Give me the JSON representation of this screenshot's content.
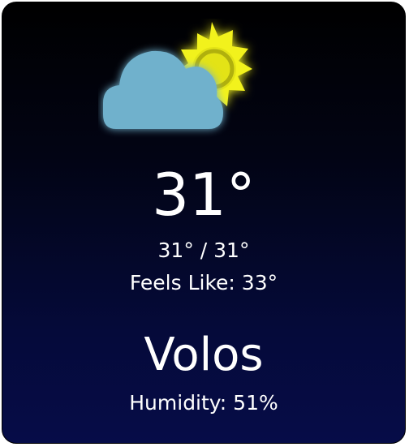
{
  "weather": {
    "icon": "partly-cloudy-day-icon",
    "temperature": "31°",
    "range": "31° / 31°",
    "feels_like_label": "Feels Like:",
    "feels_like_value": "33°",
    "city": "Volos",
    "humidity_label": "Humidity:",
    "humidity_value": "51%"
  },
  "colors": {
    "sun": "#f2f21a",
    "sun_glow": "#f7f71f",
    "cloud": "#6fb1cc",
    "card_top": "#000000",
    "card_bottom": "#060c48",
    "text": "#ffffff"
  }
}
